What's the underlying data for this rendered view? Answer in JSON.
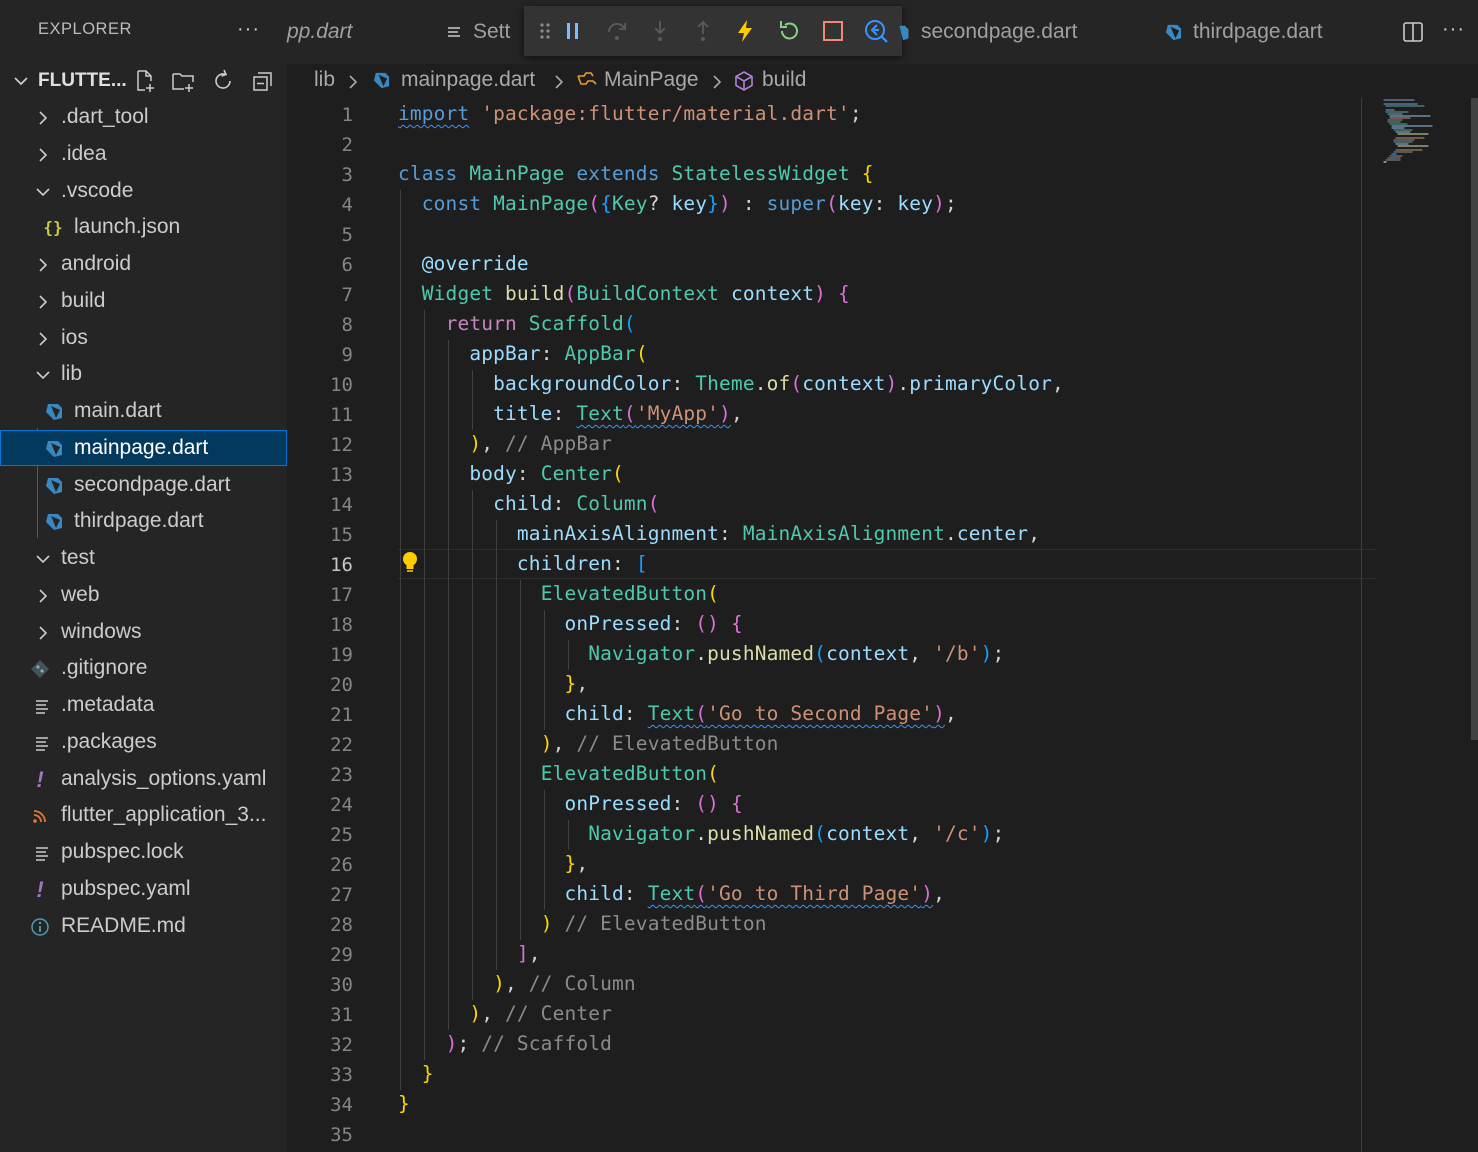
{
  "sidebar": {
    "title": "EXPLORER",
    "more": "···",
    "project": "FLUTTE...",
    "items": [
      {
        "label": ".dart_tool",
        "type": "folder",
        "expanded": false
      },
      {
        "label": ".idea",
        "type": "folder",
        "expanded": false
      },
      {
        "label": ".vscode",
        "type": "folder",
        "expanded": true
      },
      {
        "label": "launch.json",
        "type": "json"
      },
      {
        "label": "android",
        "type": "folder",
        "expanded": false
      },
      {
        "label": "build",
        "type": "folder",
        "expanded": false
      },
      {
        "label": "ios",
        "type": "folder",
        "expanded": false
      },
      {
        "label": "lib",
        "type": "folder",
        "expanded": true
      },
      {
        "label": "main.dart",
        "type": "dart"
      },
      {
        "label": "mainpage.dart",
        "type": "dart",
        "selected": true
      },
      {
        "label": "secondpage.dart",
        "type": "dart"
      },
      {
        "label": "thirdpage.dart",
        "type": "dart"
      },
      {
        "label": "test",
        "type": "folder",
        "expanded": true
      },
      {
        "label": "web",
        "type": "folder",
        "expanded": false
      },
      {
        "label": "windows",
        "type": "folder",
        "expanded": false
      },
      {
        "label": ".gitignore",
        "type": "git"
      },
      {
        "label": ".metadata",
        "type": "lines"
      },
      {
        "label": ".packages",
        "type": "lines"
      },
      {
        "label": "analysis_options.yaml",
        "type": "yaml"
      },
      {
        "label": "flutter_application_3...",
        "type": "rss"
      },
      {
        "label": "pubspec.lock",
        "type": "lines"
      },
      {
        "label": "pubspec.yaml",
        "type": "yaml"
      },
      {
        "label": "README.md",
        "type": "info"
      }
    ]
  },
  "tabs": {
    "t1": "pp.dart",
    "t2": "Sett",
    "t3": "secondpage.dart",
    "t4": "thirdpage.dart"
  },
  "breadcrumb": {
    "b1": "lib",
    "b2": "mainpage.dart",
    "b3": "MainPage",
    "b4": "build"
  },
  "editor": {
    "active_line": 16,
    "line_count": 35
  },
  "colors": {
    "selection": "#04395e",
    "accent": "#0078d4",
    "debug_pause": "#75beff",
    "debug_restart": "#89d185",
    "debug_stop": "#f48771",
    "hot_reload": "#ffcc00"
  },
  "code": [
    {
      "line": 1,
      "text": "import 'package:flutter/material.dart';"
    },
    {
      "line": 2,
      "text": ""
    },
    {
      "line": 3,
      "text": "class MainPage extends StatelessWidget {"
    },
    {
      "line": 4,
      "text": "  const MainPage({Key? key}) : super(key: key);"
    },
    {
      "line": 5,
      "text": ""
    },
    {
      "line": 6,
      "text": "  @override"
    },
    {
      "line": 7,
      "text": "  Widget build(BuildContext context) {"
    },
    {
      "line": 8,
      "text": "    return Scaffold("
    },
    {
      "line": 9,
      "text": "      appBar: AppBar("
    },
    {
      "line": 10,
      "text": "        backgroundColor: Theme.of(context).primaryColor,"
    },
    {
      "line": 11,
      "text": "        title: Text('MyApp'),"
    },
    {
      "line": 12,
      "text": "      ), // AppBar"
    },
    {
      "line": 13,
      "text": "      body: Center("
    },
    {
      "line": 14,
      "text": "        child: Column("
    },
    {
      "line": 15,
      "text": "          mainAxisAlignment: MainAxisAlignment.center,"
    },
    {
      "line": 16,
      "text": "          children: ["
    },
    {
      "line": 17,
      "text": "            ElevatedButton("
    },
    {
      "line": 18,
      "text": "              onPressed: () {"
    },
    {
      "line": 19,
      "text": "                Navigator.pushNamed(context, '/b');"
    },
    {
      "line": 20,
      "text": "              },"
    },
    {
      "line": 21,
      "text": "              child: Text('Go to Second Page'),"
    },
    {
      "line": 22,
      "text": "            ), // ElevatedButton"
    },
    {
      "line": 23,
      "text": "            ElevatedButton("
    },
    {
      "line": 24,
      "text": "              onPressed: () {"
    },
    {
      "line": 25,
      "text": "                Navigator.pushNamed(context, '/c');"
    },
    {
      "line": 26,
      "text": "              },"
    },
    {
      "line": 27,
      "text": "              child: Text('Go to Third Page'),"
    },
    {
      "line": 28,
      "text": "            ) // ElevatedButton"
    },
    {
      "line": 29,
      "text": "          ],"
    },
    {
      "line": 30,
      "text": "        ), // Column"
    },
    {
      "line": 31,
      "text": "      ), // Center"
    },
    {
      "line": 32,
      "text": "    ); // Scaffold"
    },
    {
      "line": 33,
      "text": "  }"
    },
    {
      "line": 34,
      "text": "}"
    },
    {
      "line": 35,
      "text": ""
    }
  ]
}
